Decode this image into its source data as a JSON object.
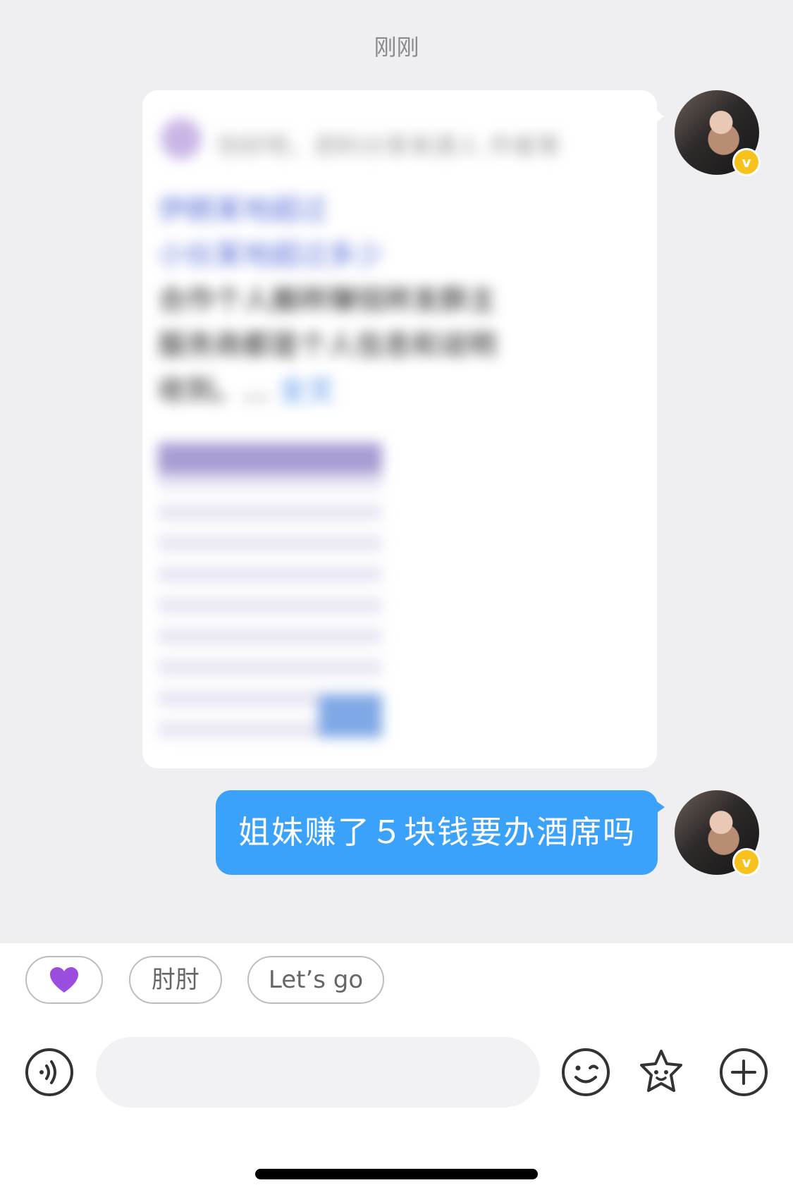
{
  "chat": {
    "timestamp": "刚刚",
    "shared_card": {
      "header_text": "你好呀，资料分享来源人 作者等",
      "body_lines": [
        "伊朗某地超过",
        "小伙某地超过多少",
        "合作个人搬砖赚钱转发群主",
        "服务商都是个人信息和说明",
        "收到。..."
      ],
      "more_label": "全文"
    },
    "outgoing_message": "姐妹赚了５块钱要办酒席吗"
  },
  "quick_replies": {
    "chip_1": "💜",
    "chip_2": "肘肘",
    "chip_3": "Let’s go"
  },
  "input_bar": {
    "placeholder": "",
    "icons": [
      "voice-icon",
      "emoji-icon",
      "sticker-icon",
      "plus-icon"
    ]
  },
  "colors": {
    "chat_background": "#efeff1",
    "outgoing_bubble": "#3aa2fb",
    "verified_badge": "#f7c21b",
    "heart": "#9b4de0"
  }
}
